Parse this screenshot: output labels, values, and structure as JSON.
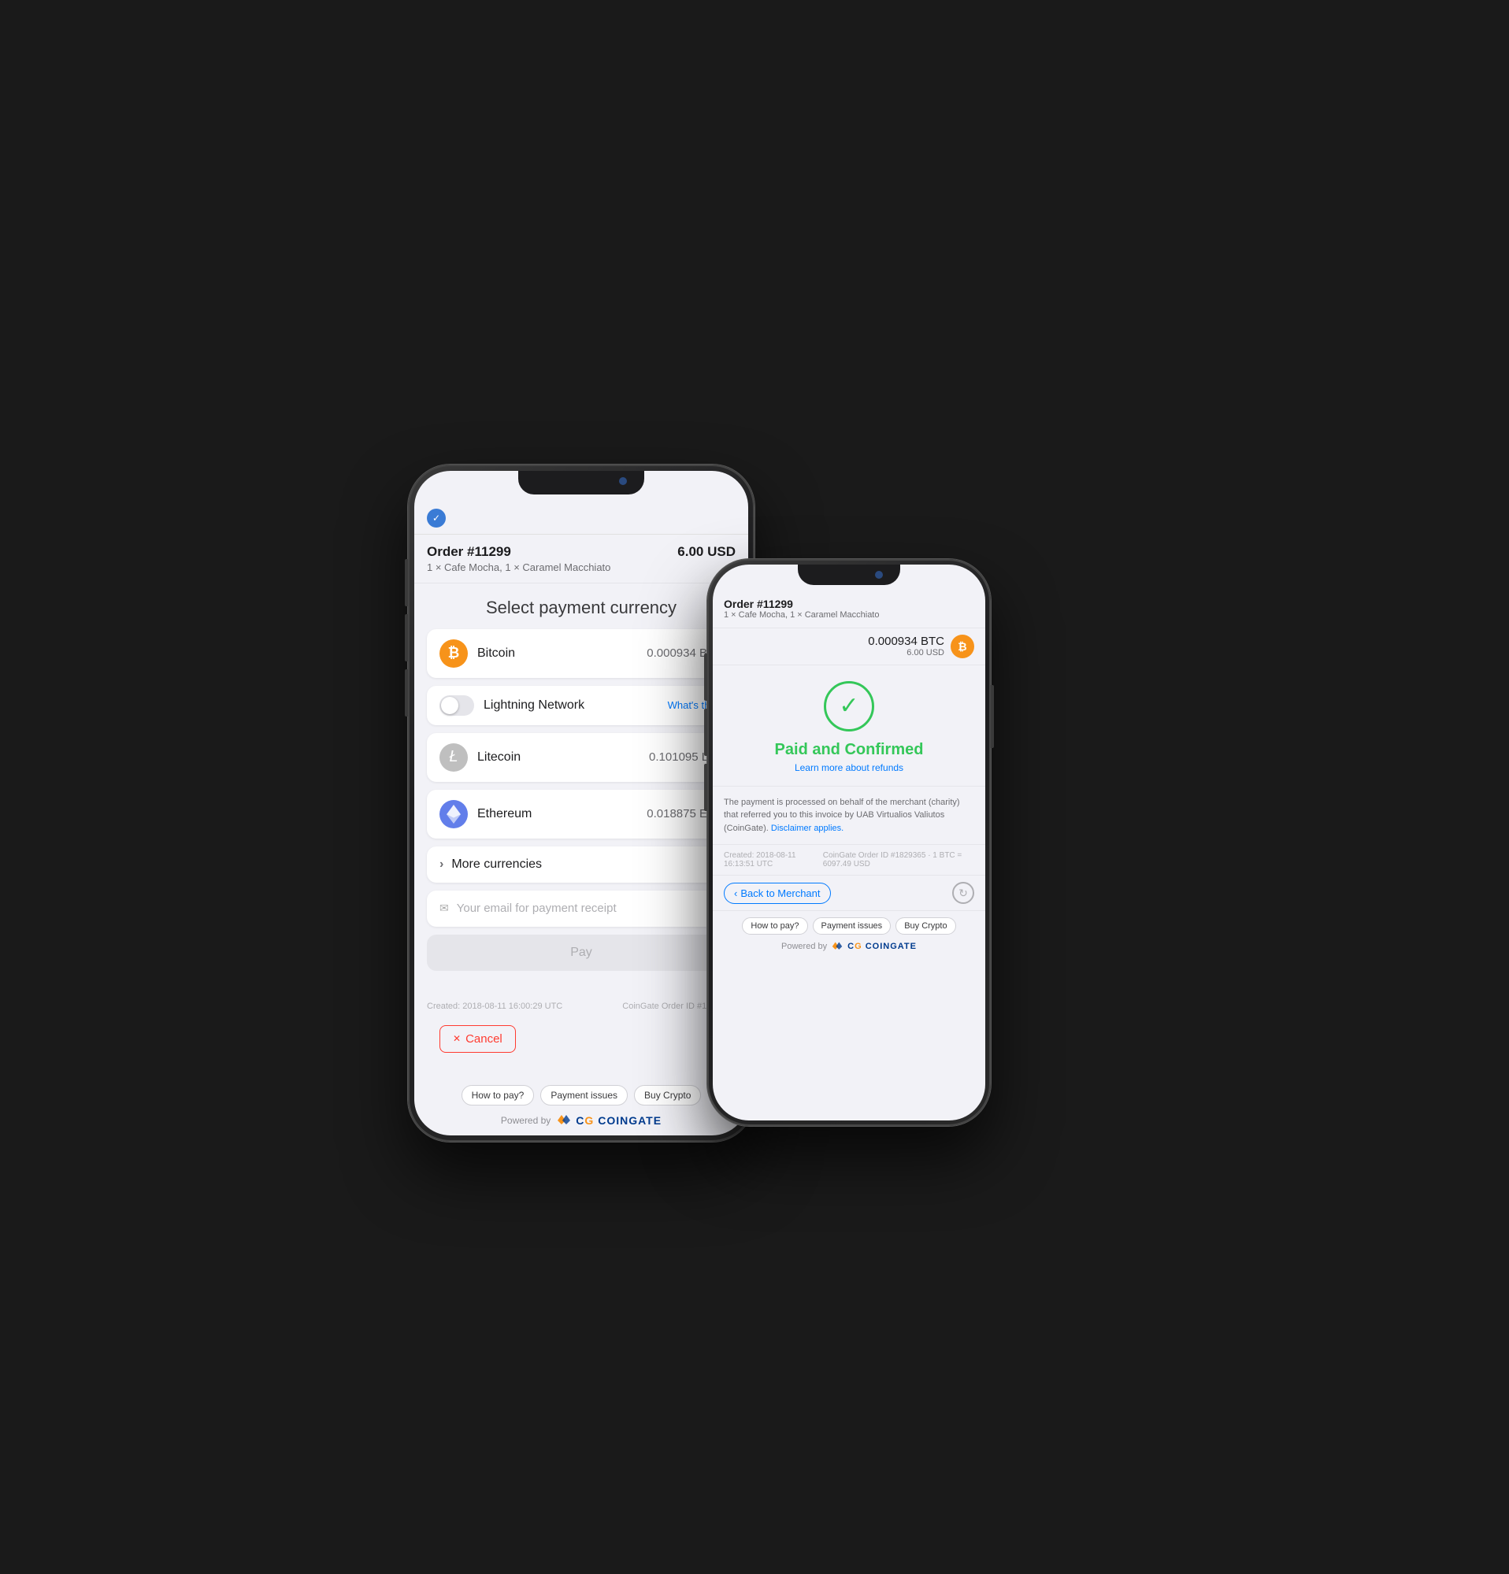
{
  "phone1": {
    "verified_icon": "✓",
    "order": {
      "number": "Order #11299",
      "amount": "6.00 USD",
      "items": "1 × Cafe Mocha, 1 × Caramel Macchiato"
    },
    "select_title": "Select payment currency",
    "currencies": [
      {
        "name": "Bitcoin",
        "amount": "0.000934 BTC",
        "icon_type": "btc",
        "symbol": "₿"
      },
      {
        "name": "Litecoin",
        "amount": "0.101095 LTC",
        "icon_type": "ltc",
        "symbol": "Ł"
      },
      {
        "name": "Ethereum",
        "amount": "0.018875 ETH",
        "icon_type": "eth",
        "symbol": "◆"
      }
    ],
    "lightning": {
      "label": "Lightning Network",
      "whats_this": "What's this?"
    },
    "more_currencies": "More currencies",
    "email_placeholder": "Your email for payment receipt",
    "pay_button": "Pay",
    "footer_left": "Created: 2018-08-11 16:00:29 UTC",
    "footer_right": "CoinGate Order ID #1829365",
    "cancel_label": "Cancel",
    "bottom_links": [
      "How to pay?",
      "Payment issues",
      "Buy Crypto"
    ],
    "powered_by": "Powered by",
    "coingate_text": "COINGATE"
  },
  "phone2": {
    "order": {
      "number": "Order #11299",
      "items": "1 × Cafe Mocha, 1 × Caramel Macchiato"
    },
    "btc_amount": "0.000934 BTC",
    "usd_amount": "6.00 USD",
    "btc_symbol": "₿",
    "paid_confirmed": "Paid and Confirmed",
    "learn_more": "Learn more about refunds",
    "check_icon": "✓",
    "disclaimer": "The payment is processed on behalf of the merchant (charity) that referred you to this invoice by UAB Virtualios Valiutos (CoinGate).",
    "disclaimer_link": "Disclaimer applies.",
    "meta_left": "Created: 2018-08-11  16:13:51 UTC",
    "meta_right": "CoinGate Order ID #1829365 · 1 BTC = 6097.49 USD",
    "back_merchant": "Back to Merchant",
    "bottom_links": [
      "How to pay?",
      "Payment issues",
      "Buy Crypto"
    ],
    "powered_by": "Powered by",
    "coingate_text": "COINGATE"
  }
}
